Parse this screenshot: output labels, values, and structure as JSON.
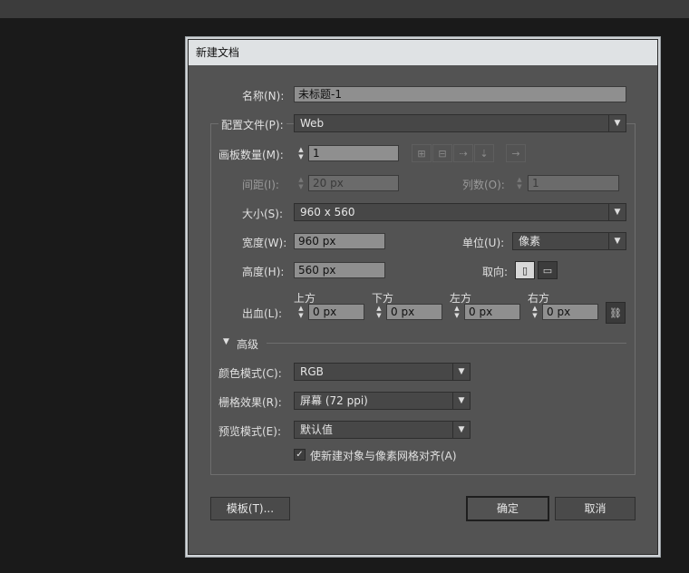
{
  "dialog": {
    "title": "新建文档",
    "name_label": "名称(N):",
    "name_value": "未标题-1",
    "profile_label": "配置文件(P):",
    "profile_value": "Web",
    "artboards_label": "画板数量(M):",
    "artboards_value": "1",
    "spacing_label": "间距(I):",
    "spacing_value": "20 px",
    "columns_label": "列数(O):",
    "columns_value": "1",
    "size_label": "大小(S):",
    "size_value": "960 x 560",
    "width_label": "宽度(W):",
    "width_value": "960 px",
    "units_label": "单位(U):",
    "units_value": "像素",
    "height_label": "高度(H):",
    "height_value": "560 px",
    "orientation_label": "取向:",
    "bleed_label": "出血(L):",
    "bleed": {
      "top_label": "上方",
      "top_value": "0 px",
      "bottom_label": "下方",
      "bottom_value": "0 px",
      "left_label": "左方",
      "left_value": "0 px",
      "right_label": "右方",
      "right_value": "0 px"
    },
    "advanced_label": "高级",
    "color_mode_label": "颜色模式(C):",
    "color_mode_value": "RGB",
    "raster_label": "栅格效果(R):",
    "raster_value": "屏幕 (72 ppi)",
    "preview_label": "预览模式(E):",
    "preview_value": "默认值",
    "align_pixel_label": "使新建对象与像素网格对齐(A)",
    "align_pixel_checked": true,
    "templates_button": "模板(T)...",
    "ok_button": "确定",
    "cancel_button": "取消"
  },
  "icons": {
    "dropdown": "▼",
    "spin_up": "▲",
    "spin_down": "▼",
    "check": "✓",
    "link": "⛓"
  }
}
